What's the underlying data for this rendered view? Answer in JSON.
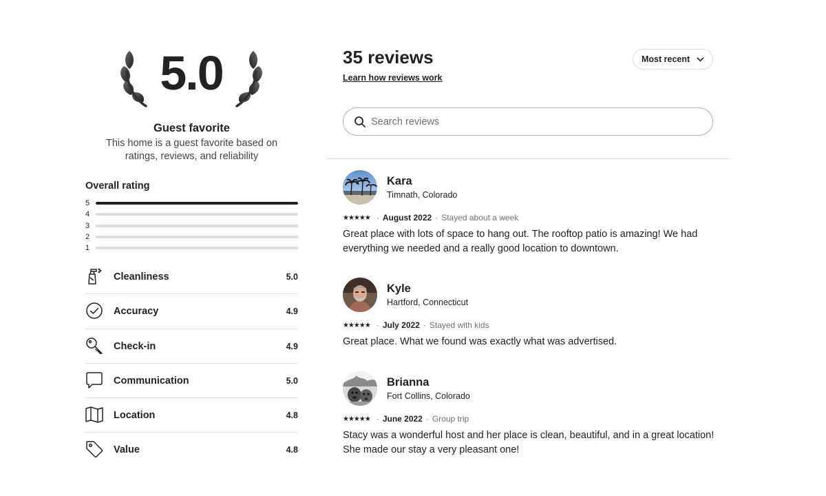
{
  "summary": {
    "score": "5.0",
    "badge_title": "Guest favorite",
    "badge_description": "This home is a guest favorite based on ratings, reviews, and reliability"
  },
  "overall": {
    "label": "Overall rating",
    "distribution": [
      {
        "stars": "5",
        "fraction": 1.0
      },
      {
        "stars": "4",
        "fraction": 0.0
      },
      {
        "stars": "3",
        "fraction": 0.0
      },
      {
        "stars": "2",
        "fraction": 0.0
      },
      {
        "stars": "1",
        "fraction": 0.0
      }
    ]
  },
  "categories": [
    {
      "label": "Cleanliness",
      "score": "5.0",
      "icon": "spray-bottle-icon"
    },
    {
      "label": "Accuracy",
      "score": "4.9",
      "icon": "check-circle-icon"
    },
    {
      "label": "Check-in",
      "score": "4.9",
      "icon": "key-icon"
    },
    {
      "label": "Communication",
      "score": "5.0",
      "icon": "chat-bubble-icon"
    },
    {
      "label": "Location",
      "score": "4.8",
      "icon": "map-icon"
    },
    {
      "label": "Value",
      "score": "4.8",
      "icon": "price-tag-icon"
    }
  ],
  "reviews_header": {
    "count_label": "35 reviews",
    "learn_link": "Learn how reviews work",
    "sort_label": "Most recent",
    "search_placeholder": "Search reviews"
  },
  "reviews": [
    {
      "name": "Kara",
      "location": "Timnath, Colorado",
      "stars": "★★★★★",
      "date": "August 2022",
      "trip": "Stayed about a week",
      "text": "Great place with lots of space to hang out. The rooftop patio is amazing! We had everything we needed and a really good location to downtown."
    },
    {
      "name": "Kyle",
      "location": "Hartford, Connecticut",
      "stars": "★★★★★",
      "date": "July 2022",
      "trip": "Stayed with kids",
      "text": "Great place. What we found was exactly what was advertised."
    },
    {
      "name": "Brianna",
      "location": "Fort Collins, Colorado",
      "stars": "★★★★★",
      "date": "June 2022",
      "trip": "Group trip",
      "text": "Stacy was a wonderful host and her place is clean, beautiful, and in a great location! She made our stay a very pleasant one!"
    }
  ],
  "colors": {
    "text": "#222222",
    "muted": "#717171",
    "divider": "#dddddd",
    "bar_empty": "#dddddd",
    "bar_filled": "#222222"
  }
}
